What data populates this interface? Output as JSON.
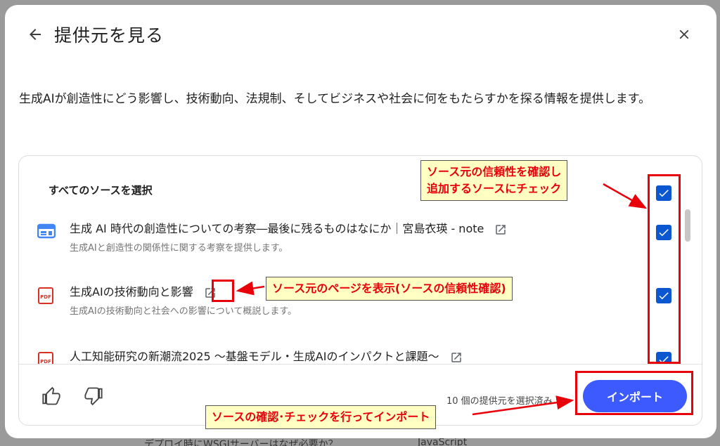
{
  "background": {
    "bottom_text": "デプロイ時にWSGIサーバーはなぜ必要か？",
    "bottom_text2": "JavaScript"
  },
  "dialog": {
    "title": "提供元を見る",
    "description": "生成AIが創造性にどう影響し、技術動向、法規制、そしてビジネスや社会に何をもたらすかを探る情報を提供します。",
    "select_all_label": "すべてのソースを選択",
    "sources": [
      {
        "icon": "web-page-icon",
        "title": "生成 AI 時代の創造性についての考察―最後に残るものはなにか｜宮島衣瑛 - note",
        "description": "生成AIと創造性の関係性に関する考察を提供します。",
        "checked": true
      },
      {
        "icon": "pdf-icon",
        "title": "生成AIの技術動向と影響",
        "description": "生成AIの技術動向と社会への影響について概説します。",
        "checked": true
      },
      {
        "icon": "pdf-icon",
        "title": "人工知能研究の新潮流2025 〜基盤モデル・生成AIのインパクトと課題〜",
        "description": "",
        "checked": true
      }
    ],
    "selected_count": "10 個の提供元を選択済み",
    "import_label": "インポート"
  },
  "annotations": {
    "checkbox_callout": "ソース元の信頼性を確認し\n追加するソースにチェック",
    "link_callout": "ソース元のページを表示(ソースの信頼性確認)",
    "import_callout": "ソースの確認･チェックを行ってインポート"
  },
  "colors": {
    "accent": "#0b57d0",
    "import_button": "#3d5afe",
    "annotation_red": "#e8000b",
    "callout_bg": "#ffffc4",
    "pdf_red": "#d93025",
    "web_blue": "#4285f4"
  }
}
